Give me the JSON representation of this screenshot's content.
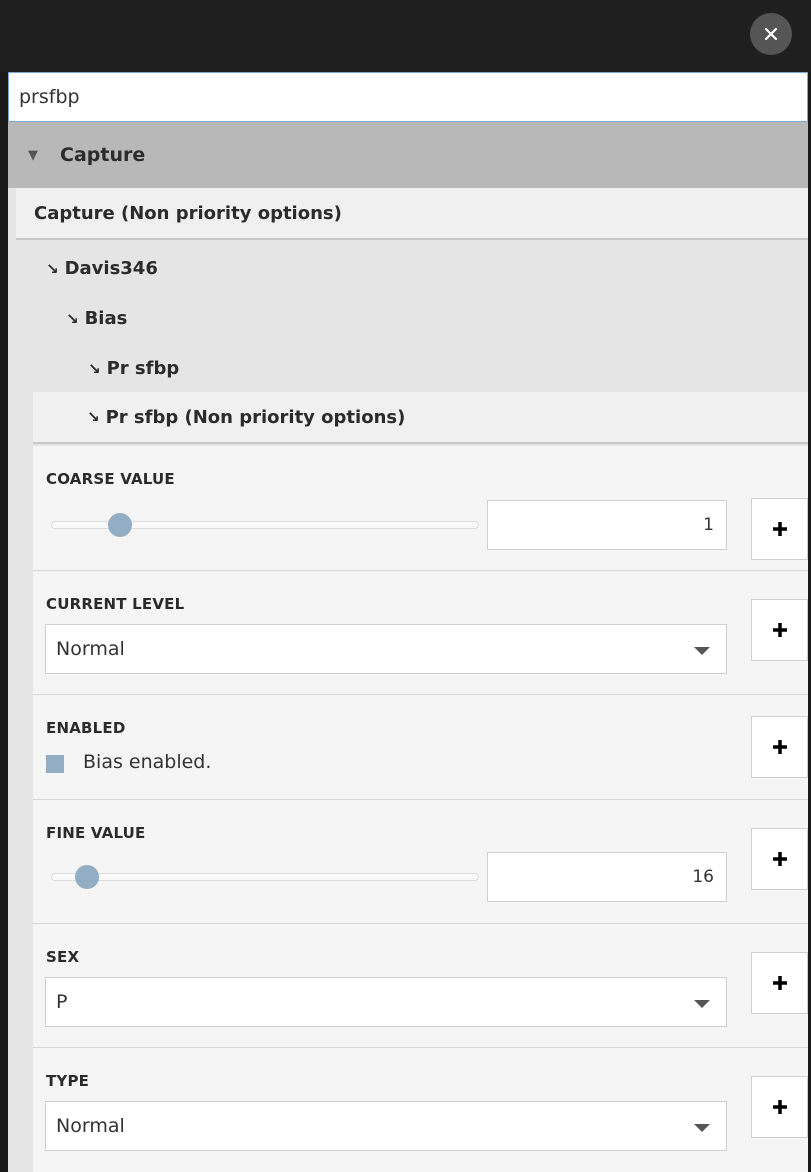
{
  "search": {
    "value": "prsfbp"
  },
  "tree": {
    "capture_header": "Capture",
    "capture_nonpriority": "Capture (Non priority options)",
    "node_device": "Davis346",
    "node_bias": "Bias",
    "node_bias_item": "Pr sfbp",
    "node_bias_item_nonpriority": "Pr sfbp (Non priority options)"
  },
  "properties": {
    "coarse_value": {
      "label": "COARSE VALUE",
      "value": "1",
      "slider_fraction": 0.14
    },
    "current_level": {
      "label": "CURRENT LEVEL",
      "selected": "Normal"
    },
    "enabled": {
      "label": "ENABLED",
      "checkbox_label": "Bias enabled."
    },
    "fine_value": {
      "label": "FINE VALUE",
      "value": "16",
      "slider_fraction": 0.06
    },
    "sex": {
      "label": "SEX",
      "selected": "P"
    },
    "type": {
      "label": "TYPE",
      "selected": "Normal"
    }
  },
  "colors": {
    "accent": "#93aec4",
    "topbar": "#1f1f1f",
    "header_gray": "#b8b8b8"
  },
  "icons": {
    "close": "close-icon",
    "expand": "triangle-down-icon",
    "tree_arrow": "arrow-down-right-icon",
    "add": "plus-icon",
    "dropdown": "caret-down-icon"
  }
}
